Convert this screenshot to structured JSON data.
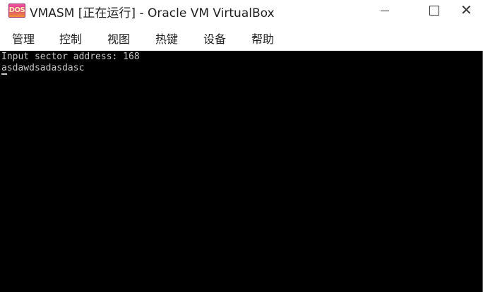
{
  "window": {
    "title": "VMASM [正在运行] - Oracle VM VirtualBox",
    "app_icon_label": "DOS",
    "controls": {
      "minimize": "minimize-icon",
      "maximize": "maximize-icon",
      "close_glyph": "✕"
    }
  },
  "menu": {
    "items": [
      {
        "label": "管理"
      },
      {
        "label": "控制"
      },
      {
        "label": "视图"
      },
      {
        "label": "热键"
      },
      {
        "label": "设备"
      },
      {
        "label": "帮助"
      }
    ]
  },
  "console": {
    "lines": [
      "Input sector address: 168",
      "asdawdsadasdasc"
    ],
    "colors": {
      "background": "#000000",
      "text": "#c8c8c8"
    }
  }
}
